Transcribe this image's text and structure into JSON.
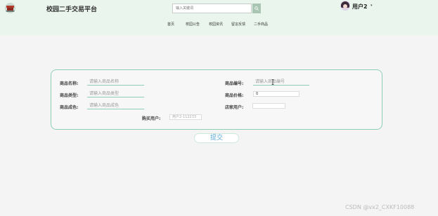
{
  "header": {
    "site_title": "校园二手交易平台",
    "search_placeholder": "输入关键词",
    "search_icon": "search-icon",
    "username": "用户2",
    "caret": "▾"
  },
  "nav": [
    "首页",
    "校园公告",
    "校园资讯",
    "留言反馈",
    "二手商品"
  ],
  "form": {
    "name_label": "商品名称:",
    "name_placeholder": "请输入商品名称",
    "number_label": "商品编号:",
    "number_placeholder": "请输入商品编号",
    "type_label": "商品类型:",
    "type_placeholder": "请输入商品类型",
    "price_label": "商品价格:",
    "price_value": "0",
    "condition_label": "商品成色:",
    "condition_placeholder": "请输入商品成色",
    "merchant_label": "店家用户:",
    "merchant_value": "",
    "buyer_label": "购买用户:",
    "buyer_value": "用户2-112233",
    "submit_label": "提交"
  },
  "watermark": "CSDN @vx2_CXKF10088",
  "colors": {
    "accent": "#8ecfb4",
    "header_bg": "#eaf5ee",
    "submit_text": "#5aa7d6"
  }
}
